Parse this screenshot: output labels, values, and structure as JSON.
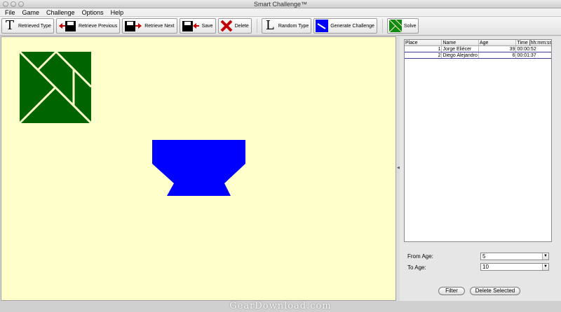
{
  "window": {
    "title": "Smart Challenge™"
  },
  "menu": [
    "File",
    "Game",
    "Challenge",
    "Options",
    "Help"
  ],
  "toolbar": {
    "retrieved_type": {
      "label": "Retrieved Type",
      "glyph": "T"
    },
    "retrieve_previous": {
      "label": "Retrieve Previous"
    },
    "retrieve_next": {
      "label": "Retrieve Next"
    },
    "save": {
      "label": "Save"
    },
    "delete": {
      "label": "Delete"
    },
    "random_type": {
      "label": "Random Type",
      "glyph": "L"
    },
    "generate_challenge": {
      "label": "Generate Challenge"
    },
    "solve": {
      "label": "Solve"
    }
  },
  "colors": {
    "canvas_bg": "#ffffcc",
    "tangram_green": "#006400",
    "tangram_lines": "#ffffcc",
    "challenge_blue": "#0000ff",
    "delete_red": "#c00000"
  },
  "scores": {
    "columns": [
      "Place",
      "Name",
      "Age",
      "Time [hh:mm:ss]"
    ],
    "rows": [
      {
        "place": "1",
        "name": "Jorge Eliécer",
        "age": "39",
        "time": "00:00:52"
      },
      {
        "place": "2",
        "name": "Diego Alejandro",
        "age": "6",
        "time": "00:01:37"
      }
    ]
  },
  "filter": {
    "from_age_label": "From Age:",
    "from_age_value": "5",
    "to_age_label": "To Age:",
    "to_age_value": "10",
    "filter_button": "Filter",
    "delete_selected_button": "Delete Selected"
  },
  "watermark": "GearDownload.com"
}
